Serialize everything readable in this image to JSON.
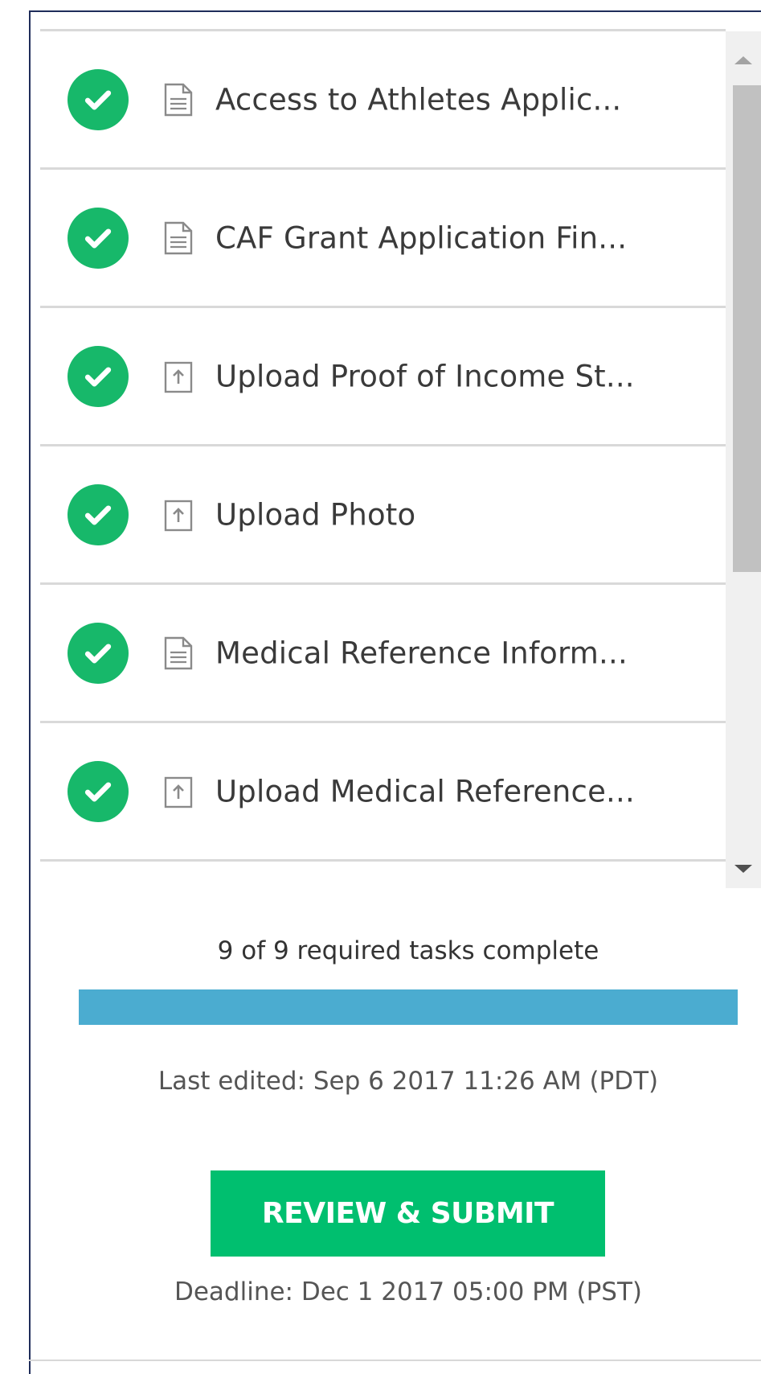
{
  "tasks": [
    {
      "label": "Access to Athletes Applic...",
      "status": "complete",
      "type_icon": "document-icon"
    },
    {
      "label": "CAF Grant Application Fin...",
      "status": "complete",
      "type_icon": "document-icon"
    },
    {
      "label": "Upload Proof of Income St...",
      "status": "complete",
      "type_icon": "upload-icon"
    },
    {
      "label": "Upload Photo",
      "status": "complete",
      "type_icon": "upload-icon"
    },
    {
      "label": "Medical Reference Inform...",
      "status": "complete",
      "type_icon": "document-icon"
    },
    {
      "label": "Upload Medical Reference...",
      "status": "complete",
      "type_icon": "upload-icon"
    }
  ],
  "summary": {
    "progress_text": "9 of 9 required tasks complete",
    "completed": 9,
    "required": 9,
    "progress_fraction": 1.0,
    "last_edited": "Last edited: Sep 6 2017 11:26 AM (PDT)",
    "submit_label": "REVIEW & SUBMIT",
    "deadline": "Deadline: Dec 1 2017 05:00 PM (PST)"
  },
  "colors": {
    "complete_green": "#17b86a",
    "button_green": "#00bf6f",
    "progress_blue": "#4bacd0"
  }
}
